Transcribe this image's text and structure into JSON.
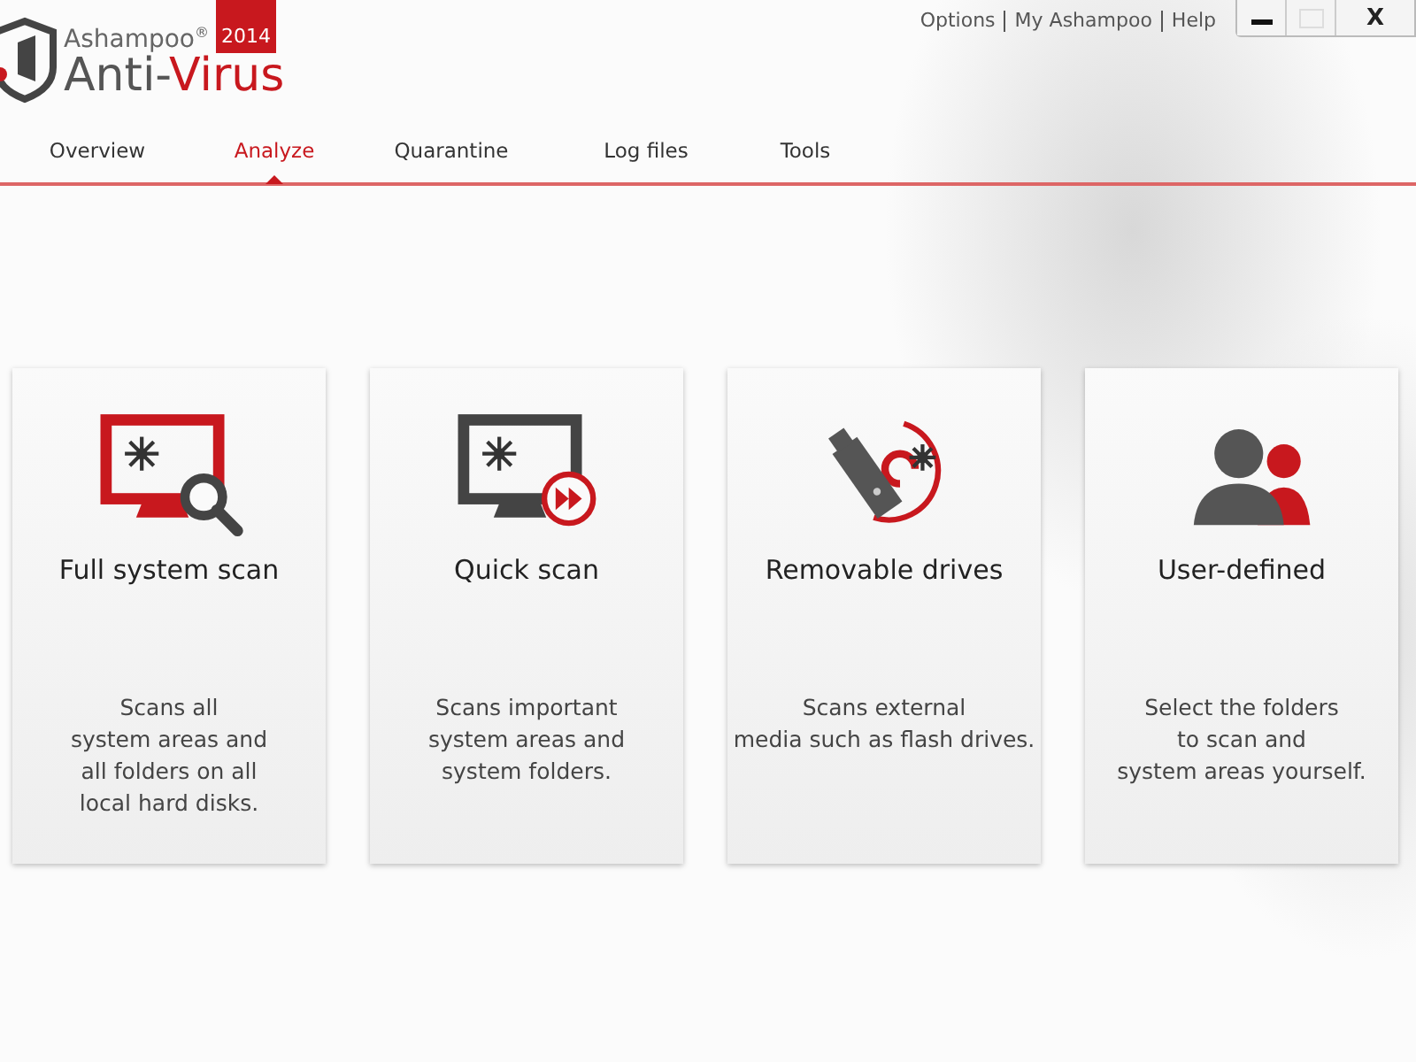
{
  "logo": {
    "brand": "Ashampoo$^{®}$",
    "product_prefix": "Anti-",
    "product_accent": "Virus",
    "year": "2014"
  },
  "top_links": [
    "Options",
    "My Ashampoo",
    "Help"
  ],
  "window_controls": {
    "close": "X",
    "maximize_disabled": true
  },
  "tabs": [
    {
      "label": "Overview",
      "selected": false
    },
    {
      "label": "Analyze",
      "selected": true
    },
    {
      "label": "Quarantine",
      "selected": false
    },
    {
      "label": "Log files",
      "selected": false
    },
    {
      "label": "Tools",
      "selected": false
    }
  ],
  "scan_cards": [
    {
      "kind": "full",
      "title": "Full system scan",
      "description": "Scans all\nsystem areas and\nall folders on all\nlocal hard disks."
    },
    {
      "kind": "quick",
      "title": "Quick scan",
      "description": "Scans important\nsystem areas and\nsystem folders."
    },
    {
      "kind": "removable",
      "title": "Removable drives",
      "description": "Scans external\nmedia such as flash drives."
    },
    {
      "kind": "user",
      "title": "User-defined",
      "description": "Select the folders\nto scan and\nsystem areas yourself."
    }
  ]
}
